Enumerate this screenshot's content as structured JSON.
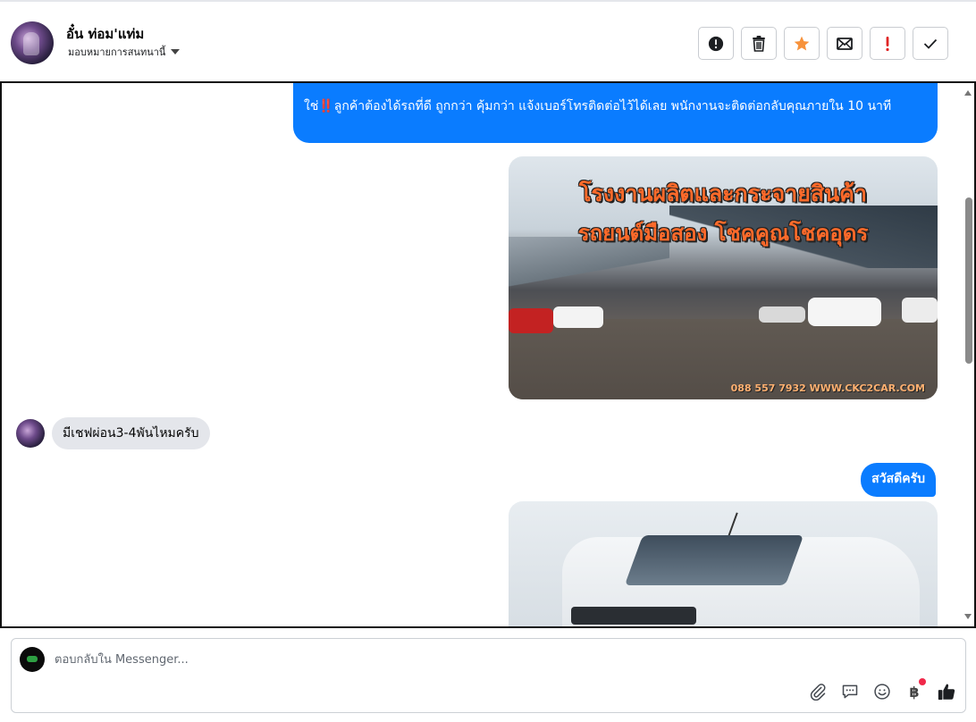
{
  "header": {
    "contact_name": "อั๋น ท่อม'แท่ม",
    "assign_label": "มอบหมายการสนทนานี้",
    "actions": [
      {
        "name": "mark-spam-button",
        "icon": "alert-circle-icon"
      },
      {
        "name": "delete-button",
        "icon": "trash-icon"
      },
      {
        "name": "star-button",
        "icon": "star-icon",
        "color": "#f7923b"
      },
      {
        "name": "mark-unread-button",
        "icon": "envelope-icon"
      },
      {
        "name": "follow-up-button",
        "icon": "exclamation-icon",
        "color": "#e02424"
      },
      {
        "name": "mark-done-button",
        "icon": "checkmark-icon"
      }
    ]
  },
  "messages": {
    "outgoing_1": {
      "prefix": "ใช่",
      "emoji": "‼️",
      "text": "ลูกค้าต้องได้รถที่ดี ถูกกว่า คุ้มกว่า แจ้งเบอร์โทรติดต่อไว้ได้เลย พนักงานจะติดต่อกลับคุณภายใน 10 นาที"
    },
    "image_1": {
      "title_line1": "โรงงานผลิตและกระจายสินค้า",
      "title_line2": "รถยนต์มือสอง โชคคูณโชคอุดร",
      "footer": "088 557 7932 WWW.CKC2CAR.COM"
    },
    "incoming_1": "มีเชฟผ่อน3-4พันไหมครับ",
    "outgoing_2": "สวัสดีครับ"
  },
  "composer": {
    "placeholder": "ตอบกลับใน Messenger...",
    "tools": [
      "paperclip-icon",
      "saved-replies-icon",
      "emoji-icon",
      "baht-icon",
      "thumbs-up-icon"
    ],
    "baht_symbol": "฿"
  },
  "colors": {
    "accent": "#0a7cff",
    "incoming_bubble": "#e4e6eb",
    "star": "#f7923b",
    "alert": "#e02424",
    "badge_dot": "#f02849"
  }
}
